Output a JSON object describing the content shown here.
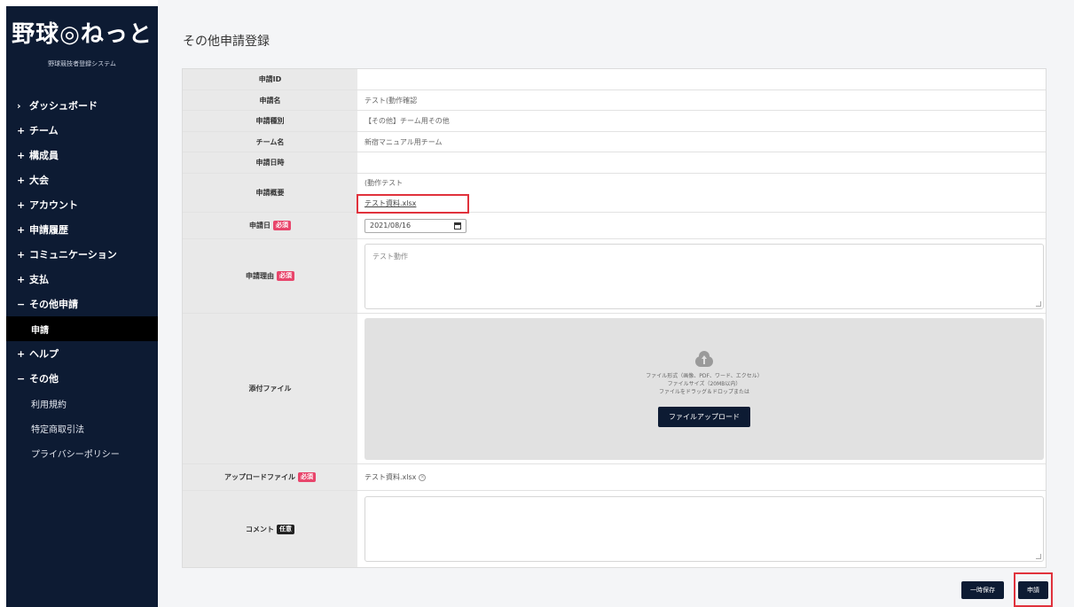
{
  "brand": {
    "logo": "野球◎ねっと",
    "tagline": "野球競技者登録システム"
  },
  "sidebar": {
    "items": [
      {
        "sign": "›",
        "label": "ダッシュボード"
      },
      {
        "sign": "+",
        "label": "チーム"
      },
      {
        "sign": "+",
        "label": "構成員"
      },
      {
        "sign": "+",
        "label": "大会"
      },
      {
        "sign": "+",
        "label": "アカウント"
      },
      {
        "sign": "+",
        "label": "申請履歴"
      },
      {
        "sign": "+",
        "label": "コミュニケーション"
      },
      {
        "sign": "+",
        "label": "支払"
      },
      {
        "sign": "−",
        "label": "その他申請"
      },
      {
        "sign": "",
        "label": "申請",
        "active": true
      },
      {
        "sign": "+",
        "label": "ヘルプ"
      },
      {
        "sign": "−",
        "label": "その他"
      },
      {
        "sign": "",
        "label": "利用規約"
      },
      {
        "sign": "",
        "label": "特定商取引法"
      },
      {
        "sign": "",
        "label": "プライバシーポリシー"
      }
    ]
  },
  "page": {
    "title": "その他申請登録"
  },
  "form": {
    "id_label": "申請ID",
    "id_value": "",
    "name_label": "申請名",
    "name_value": "テスト(動作確認",
    "type_label": "申請種別",
    "type_value": "【その他】チーム用その他",
    "team_label": "チーム名",
    "team_value": "新宿マニュアル用チーム",
    "datetime_label": "申請日時",
    "datetime_value": "",
    "summary_label": "申請概要",
    "summary_value": "(動作テスト",
    "summary_file": "テスト資料.xlsx",
    "date_label": "申請日",
    "date_badge": "必須",
    "date_value": "2021/08/16",
    "reason_label": "申請理由",
    "reason_badge": "必須",
    "reason_value": "テスト動作",
    "attach_label": "添付ファイル",
    "dz_line1": "ファイル形式（画像、PDF、ワード、エクセル）",
    "dz_line2": "ファイルサイズ（20MB以内）",
    "dz_line3": "ファイルをドラッグ＆ドロップまたは",
    "upload_button": "ファイルアップロード",
    "uploaded_label": "アップロードファイル",
    "uploaded_badge": "必須",
    "uploaded_file": "テスト資料.xlsx",
    "comment_label": "コメント",
    "comment_badge": "任意",
    "comment_value": ""
  },
  "actions": {
    "save_draft": "一時保存",
    "submit": "申請"
  },
  "colors": {
    "sidebar": "#0d1b33",
    "required": "#e8456b",
    "highlight": "#e0323c"
  }
}
